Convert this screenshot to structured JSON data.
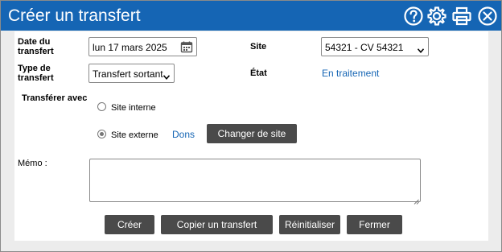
{
  "window": {
    "title": "Créer un transfert"
  },
  "toolbar_icons": [
    "help-icon",
    "gear-icon",
    "print-icon",
    "close-icon"
  ],
  "form": {
    "date_label": "Date du transfert",
    "date_value": "lun 17 mars 2025",
    "site_label": "Site",
    "site_value": "54321 - CV 54321",
    "type_label": "Type de transfert",
    "type_value": "Transfert sortant",
    "state_label": "État",
    "state_value": "En traitement",
    "transfer_with_label": "Transférer avec",
    "radio_internal": "Site interne",
    "radio_external": "Site externe",
    "selected_radio": "external",
    "dons_link": "Dons",
    "change_site_button": "Changer de site",
    "memo_label": "Mémo :",
    "memo_value": ""
  },
  "actions": {
    "create": "Créer",
    "copy": "Copier un transfert",
    "reset": "Réinitialiser",
    "close": "Fermer"
  },
  "colors": {
    "title_bar": "#1565b4",
    "button": "#4a4a4a",
    "link": "#1565b4"
  }
}
